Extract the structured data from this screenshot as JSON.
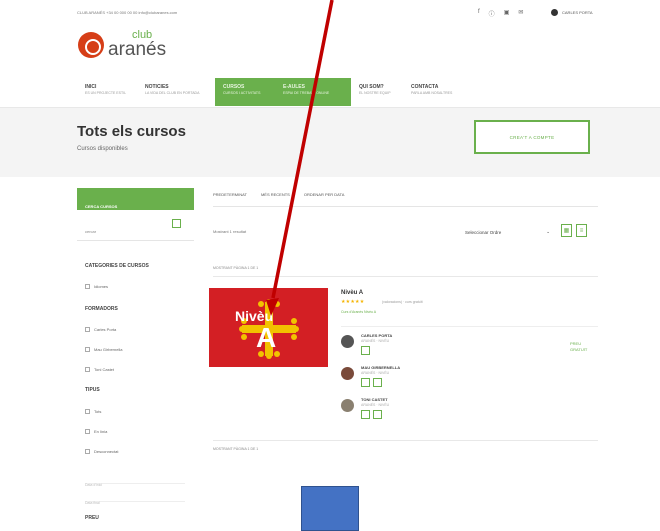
{
  "topbar": {
    "contact": "CLUB ARANÉS  +34 00 000 00 00  info@clubaranes.com",
    "socials": [
      "f",
      "ⓘ",
      "▣",
      "✉"
    ],
    "user": "CARLES PORTA"
  },
  "logo": {
    "club": "club",
    "name": "aranés"
  },
  "nav": [
    {
      "title": "INICI",
      "sub": "ES UN PROJECTE ESTIL"
    },
    {
      "title": "NOTICIES",
      "sub": "LA VIDA DEL CLUB EN PORTADA"
    },
    {
      "title": "CURSOS",
      "sub": "CURSOS I ACTIVITATS"
    },
    {
      "title": "E-AULES",
      "sub": "ESPAI DE TREBALL ONLINE"
    },
    {
      "title": "QUI SOM?",
      "sub": "EL NOSTRE EQUIP"
    },
    {
      "title": "CONTACTA",
      "sub": "PARLA AMB NOSALTRES"
    }
  ],
  "page": {
    "title": "Tots els cursos",
    "subtitle": "Cursos disponibles",
    "cta": "CREA'T A COMPTE"
  },
  "sidebar": {
    "header": "CERCA CURSOS",
    "search_label": "cercar",
    "categories_title": "CATEGORIES DE CURSOS",
    "categories": [
      "Idiomes"
    ],
    "trainers_title": "FORMADORS",
    "trainers": [
      "Carles Porta",
      "Mau Girbernella",
      "Toni Castet"
    ],
    "types_title": "TIPUS",
    "types": [
      "Tots",
      "En línia",
      "Desconnectat"
    ],
    "fields": [
      "Data d'inici",
      "Data final"
    ],
    "price_title": "PREU"
  },
  "toolbar": {
    "filters": [
      "PREDETERMINAT",
      "MÉS RECENTS",
      "ORDENAR PER DATA"
    ],
    "results": "Mostrant 1 resultat",
    "sort_label": "Seleccionar Ordre",
    "showing_top": "MOSTRANT PÀGINA 1 DE 1",
    "showing_bottom": "MOSTRANT PÀGINA 1 DE 1"
  },
  "course": {
    "thumb_title": "Nivèu",
    "thumb_letter": "A",
    "title": "Nivèu A",
    "stars": "★★★★★",
    "reviews": "(valoracions) · curs gratuït",
    "level": "Curs d'Aranès Nivèu A",
    "price": "PREU\nGRATUÏT",
    "trainers": [
      {
        "name": "CARLES PORTA",
        "role": "ARANÉS · NIVÈU"
      },
      {
        "name": "MAU GIRBERNELLA",
        "role": "ARANÉS · NIVÈU"
      },
      {
        "name": "TONI CASTET",
        "role": "ARANÉS · NIVÈU"
      }
    ]
  },
  "colors": {
    "accent": "#6ab04c",
    "thumb": "#d31f24",
    "arrow": "#c00000",
    "square": "#4472c4"
  }
}
